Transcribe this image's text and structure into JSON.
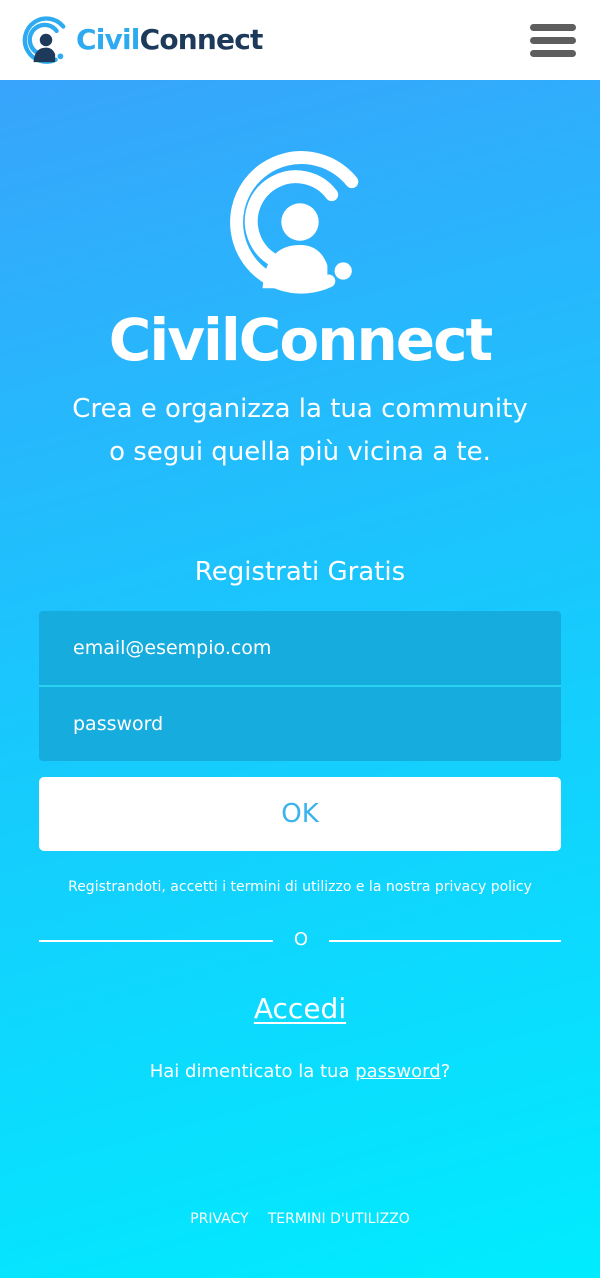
{
  "header": {
    "brand_part1": "Civil",
    "brand_part2": "Connect",
    "menu_icon": "hamburger-menu-icon",
    "logo_colors": {
      "arc": "#2daaf0",
      "person": "#1d3a5b"
    }
  },
  "hero": {
    "brand": "CivilConnect",
    "tagline_line1": "Crea e organizza la tua community",
    "tagline_line2": "o segui quella più vicina a te.",
    "logo_icon": "civilconnect-logo-icon",
    "gradient": [
      "#38a4fb",
      "#00ecfe"
    ]
  },
  "register": {
    "title": "Registrati Gratis",
    "email_placeholder": "email@esempio.com",
    "password_placeholder": "password",
    "ok_label": "OK",
    "terms_text": "Registrandoti, accetti i termini di utilizzo e la nostra privacy policy",
    "or_label": "O"
  },
  "login": {
    "accedi_label": "Accedi",
    "forgot_prefix": "Hai dimenticato la tua ",
    "forgot_link": "password",
    "forgot_suffix": "?"
  },
  "footer": {
    "privacy": "PRIVACY",
    "terms": "TERMINI D'UTILIZZO"
  }
}
